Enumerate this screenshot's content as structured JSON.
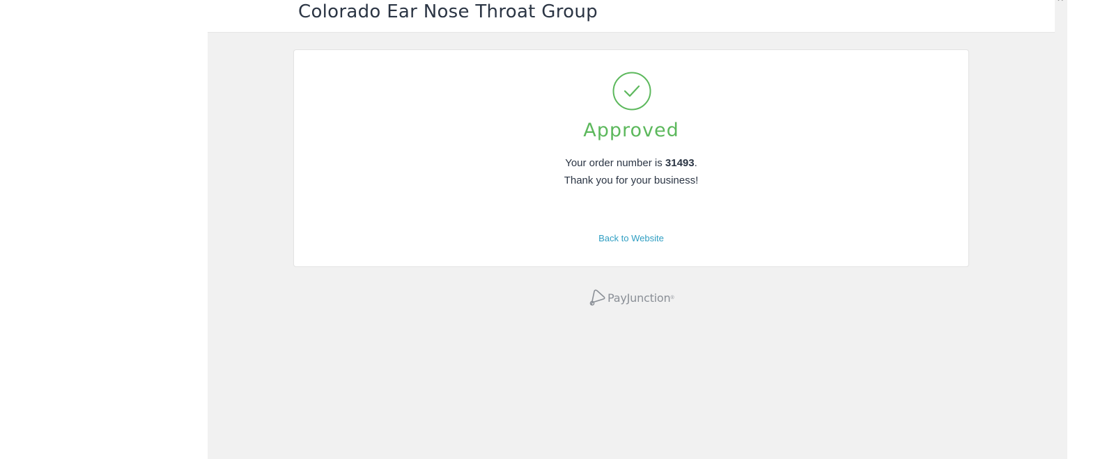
{
  "header": {
    "merchant_name": "Colorado Ear Nose Throat Group",
    "close_label": "×"
  },
  "result": {
    "icon": "check-circle-icon",
    "status": "Approved",
    "status_color": "#5cb85c",
    "order_prefix": "Your order number is ",
    "order_number": "31493",
    "order_suffix": ".",
    "thanks": "Thank you for your business!",
    "back_link": "Back to Website"
  },
  "footer": {
    "brand": "PayJunction",
    "brand_mark": "payjunction-logo-icon",
    "trademark": "®"
  },
  "colors": {
    "accent_green": "#5cb85c",
    "link_blue": "#2f9ec2",
    "panel_bg": "#f1f1f1",
    "text_dark": "#2b3544"
  }
}
